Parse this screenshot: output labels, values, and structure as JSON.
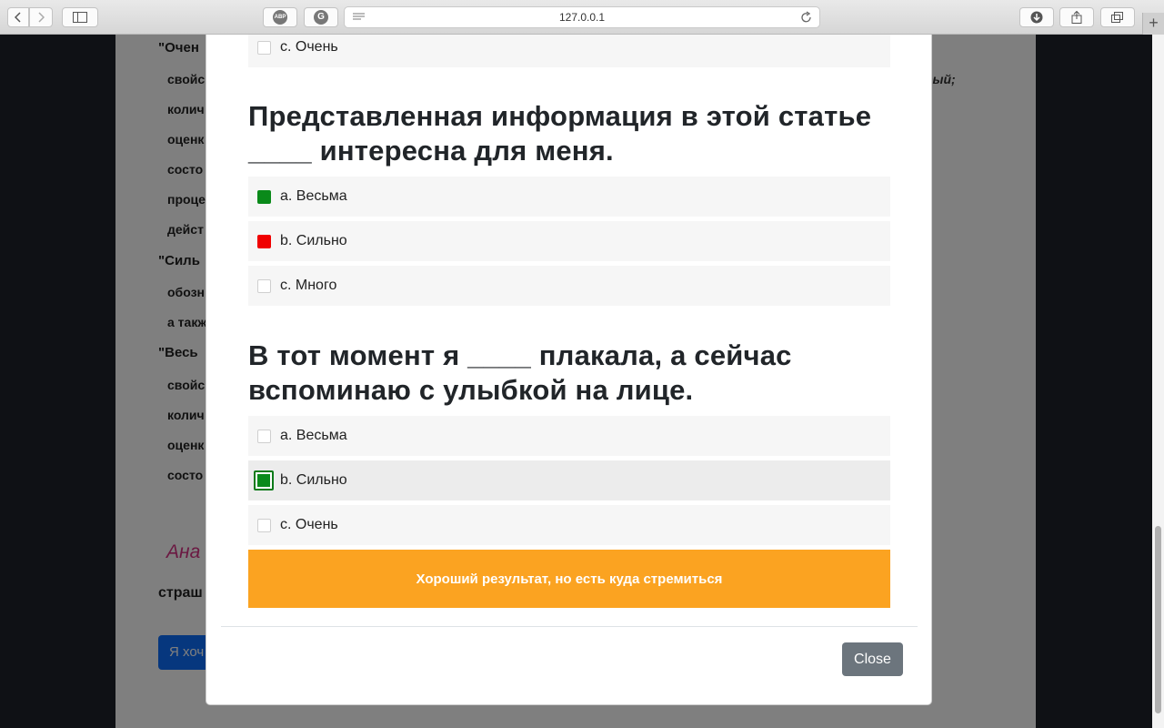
{
  "browser": {
    "url": "127.0.0.1",
    "adblock_label": "ABP"
  },
  "background_page": {
    "heading_1": "\"Очен",
    "list_1": [
      "свойс",
      "колич",
      "оценк",
      "состо",
      "проце",
      "дейст"
    ],
    "right_fragment": "рый;",
    "heading_2": "\"Силь",
    "list_2": [
      "обозн",
      "а такж"
    ],
    "heading_3": "\"Весь",
    "list_3": [
      "свойс",
      "колич",
      "оценк",
      "состо"
    ],
    "analysis_fragment": "Ана",
    "text_fragment": "страш",
    "button_fragment": "Я хоч"
  },
  "modal": {
    "top_option": "c. Очень",
    "question_1": {
      "text_line1": "Представленная информация в этой статье",
      "text_line2": "____ интересна для меня.",
      "options": [
        "a. Весьма",
        "b. Сильно",
        "c. Много"
      ]
    },
    "question_2": {
      "text_line1": "В тот момент я ____ плакала, а сейчас",
      "text_line2": "вспоминаю с улыбкой на лице.",
      "options": [
        "a. Весьма",
        "b. Сильно",
        "c. Очень"
      ]
    },
    "result_text": "Хороший результат, но есть куда стремиться",
    "close_label": "Close"
  },
  "colors": {
    "correct": "#0a8a1a",
    "wrong": "#f00000",
    "result_banner": "#fba321",
    "close_button": "#6c757d"
  }
}
